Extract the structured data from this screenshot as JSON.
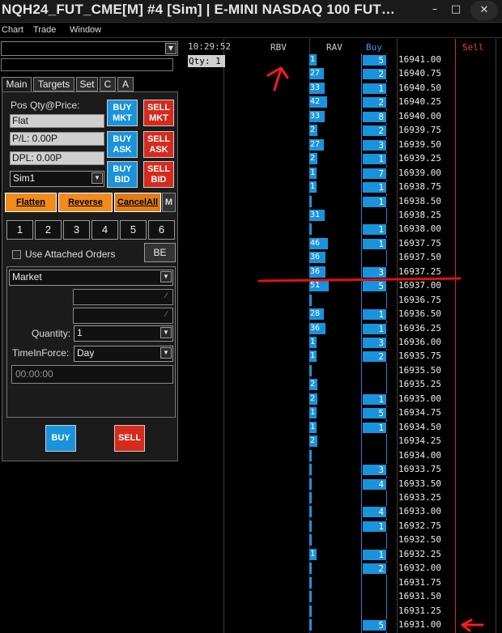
{
  "window": {
    "title": "NQH24_FUT_CME[M] #4 [Sim]  | E-MINI NASDAQ 100 FUT…",
    "minimize": "–",
    "maximize": "□",
    "close": "✕"
  },
  "menu": {
    "chart": "Chart",
    "trade": "Trade",
    "window": "Window"
  },
  "tabs": [
    "Main",
    "Targets",
    "Set",
    "C",
    "A"
  ],
  "panel": {
    "pos_label": "Pos Qty@Price:",
    "pos_value": "Flat",
    "pl_value": "P/L: 0.00P",
    "dpl_value": "DPL: 0.00P",
    "account": "Sim1",
    "buy_mkt": [
      "BUY",
      "MKT"
    ],
    "sell_mkt": [
      "SELL",
      "MKT"
    ],
    "buy_ask": [
      "BUY",
      "ASK"
    ],
    "sell_ask": [
      "SELL",
      "ASK"
    ],
    "buy_bid": [
      "BUY",
      "BID"
    ],
    "sell_bid": [
      "SELL",
      "BID"
    ],
    "flatten": "Flatten",
    "reverse": "Reverse",
    "cancel_all": "CancelAll",
    "m": "M",
    "qty_buttons": [
      "1",
      "2",
      "3",
      "4",
      "5",
      "6"
    ],
    "use_attached": "Use Attached Orders",
    "be": "BE",
    "order_type": "Market",
    "quantity_label": "Quantity:",
    "quantity_value": "1",
    "tif_label": "TimeInForce:",
    "tif_value": "Day",
    "time_value": "00:00:00",
    "buy": "BUY",
    "sell": "SELL"
  },
  "dom": {
    "time": "10:29:52",
    "qty": "Qty: 1",
    "headers": {
      "rbv": "RBV",
      "rav": "RAV",
      "buy": "Buy",
      "sell": "Sell"
    },
    "rows": [
      {
        "price": "16941.00",
        "rav": "1",
        "buy": "5"
      },
      {
        "price": "16940.75",
        "rav": "27",
        "buy": "2"
      },
      {
        "price": "16940.50",
        "rav": "33",
        "buy": "1"
      },
      {
        "price": "16940.25",
        "rav": "42",
        "buy": "2"
      },
      {
        "price": "16940.00",
        "rav": "33",
        "buy": "8"
      },
      {
        "price": "16939.75",
        "rav": "2",
        "buy": "2"
      },
      {
        "price": "16939.50",
        "rav": "27",
        "buy": "3"
      },
      {
        "price": "16939.25",
        "rav": "2",
        "buy": "1"
      },
      {
        "price": "16939.00",
        "rav": "1",
        "buy": "7"
      },
      {
        "price": "16938.75",
        "rav": "1",
        "buy": "1"
      },
      {
        "price": "16938.50",
        "rav": "",
        "buy": "1"
      },
      {
        "price": "16938.25",
        "rav": "31",
        "buy": ""
      },
      {
        "price": "16938.00",
        "rav": "",
        "buy": "1"
      },
      {
        "price": "16937.75",
        "rav": "46",
        "buy": "1"
      },
      {
        "price": "16937.50",
        "rav": "36",
        "buy": ""
      },
      {
        "price": "16937.25",
        "rav": "36",
        "buy": "3"
      },
      {
        "price": "16937.00",
        "rav": "51",
        "buy": "5"
      },
      {
        "price": "16936.75",
        "rav": "",
        "buy": ""
      },
      {
        "price": "16936.50",
        "rav": "28",
        "buy": "1"
      },
      {
        "price": "16936.25",
        "rav": "36",
        "buy": "1"
      },
      {
        "price": "16936.00",
        "rav": "1",
        "buy": "3"
      },
      {
        "price": "16935.75",
        "rav": "1",
        "buy": "2"
      },
      {
        "price": "16935.50",
        "rav": "",
        "buy": ""
      },
      {
        "price": "16935.25",
        "rav": "2",
        "buy": ""
      },
      {
        "price": "16935.00",
        "rav": "2",
        "buy": "1"
      },
      {
        "price": "16934.75",
        "rav": "1",
        "buy": "5"
      },
      {
        "price": "16934.50",
        "rav": "1",
        "buy": "1"
      },
      {
        "price": "16934.25",
        "rav": "2",
        "buy": ""
      },
      {
        "price": "16934.00",
        "rav": "",
        "buy": ""
      },
      {
        "price": "16933.75",
        "rav": "",
        "buy": "3"
      },
      {
        "price": "16933.50",
        "rav": "",
        "buy": "4"
      },
      {
        "price": "16933.25",
        "rav": "",
        "buy": ""
      },
      {
        "price": "16933.00",
        "rav": "",
        "buy": "4"
      },
      {
        "price": "16932.75",
        "rav": "",
        "buy": "1"
      },
      {
        "price": "16932.50",
        "rav": "",
        "buy": ""
      },
      {
        "price": "16932.25",
        "rav": "1",
        "buy": "1"
      },
      {
        "price": "16932.00",
        "rav": "",
        "buy": "2"
      },
      {
        "price": "16931.75",
        "rav": "",
        "buy": ""
      },
      {
        "price": "16931.50",
        "rav": "",
        "buy": ""
      },
      {
        "price": "16931.25",
        "rav": "",
        "buy": ""
      },
      {
        "price": "16931.00",
        "rav": "",
        "buy": "5"
      }
    ]
  },
  "colors": {
    "buy_blue": "#1993dc",
    "sell_red": "#d52a1c",
    "orange": "#f28a1e",
    "annotation_red": "#ff0000"
  }
}
